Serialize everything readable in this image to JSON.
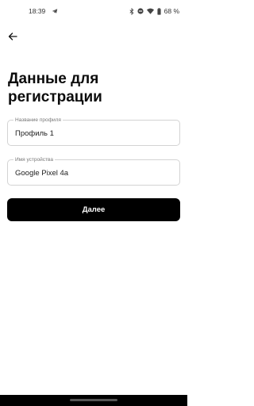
{
  "status_bar": {
    "time": "18:39",
    "battery": "68 %",
    "icons": [
      "telegram-icon",
      "bluetooth-icon",
      "do-not-disturb-icon",
      "wifi-icon",
      "battery-icon"
    ]
  },
  "header": {
    "back_icon": "back-arrow-icon",
    "title": "Данные для регистрации"
  },
  "form": {
    "profile_field": {
      "label": "Название профиля",
      "value": "Профиль 1"
    },
    "device_field": {
      "label": "Имя устройства",
      "value": "Google Pixel 4a"
    },
    "submit_label": "Далее"
  },
  "colors": {
    "button_bg": "#000000",
    "button_text": "#ffffff",
    "field_border": "#d3d3d3"
  }
}
